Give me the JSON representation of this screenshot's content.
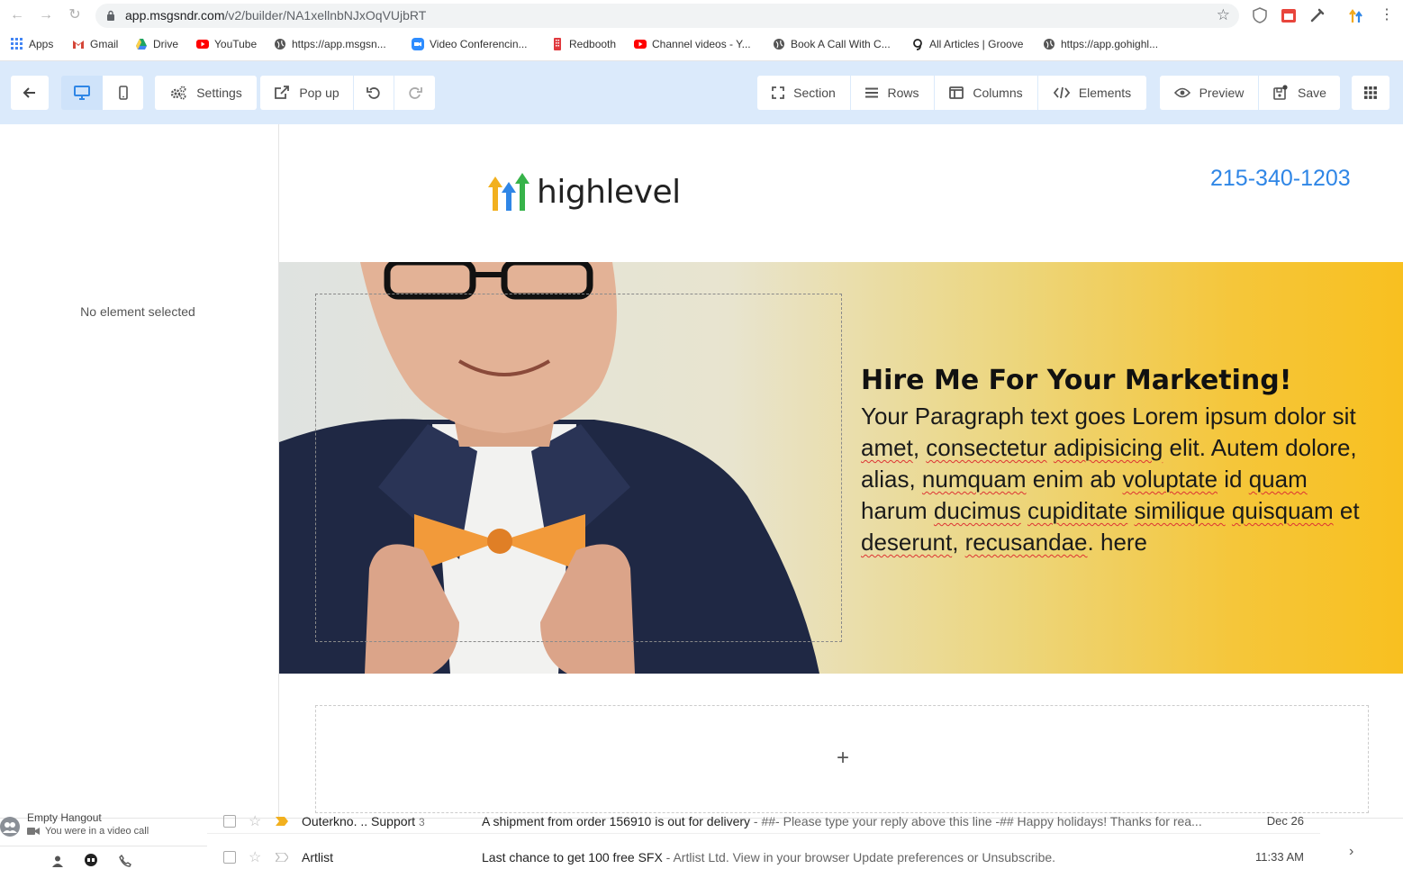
{
  "browser": {
    "url_host": "app.msgsndr.com",
    "url_path": "/v2/builder/NA1xellnbNJxOqVUjbRT",
    "bookmarks": [
      {
        "label": "Apps"
      },
      {
        "label": "Gmail"
      },
      {
        "label": "Drive"
      },
      {
        "label": "YouTube"
      },
      {
        "label": "https://app.msgsn..."
      },
      {
        "label": "Video Conferencin..."
      },
      {
        "label": "Redbooth"
      },
      {
        "label": "Channel videos - Y..."
      },
      {
        "label": "Book A Call With C..."
      },
      {
        "label": "All Articles | Groove"
      },
      {
        "label": "https://app.gohighl..."
      }
    ]
  },
  "toolbar": {
    "settings": "Settings",
    "popup": "Pop up",
    "section": "Section",
    "rows": "Rows",
    "columns": "Columns",
    "elements": "Elements",
    "preview": "Preview",
    "save": "Save"
  },
  "leftpanel": {
    "empty_text": "No element selected"
  },
  "page": {
    "logo_text": "highlevel",
    "phone": "215-340-1203",
    "hero_title": "Hire Me For Your Marketing!",
    "hero_paragraph": {
      "p1": "Your Paragraph text goes Lorem ipsum dolor sit ",
      "w1": "amet",
      "p2": ", ",
      "w2": "consectetur",
      "p3": " ",
      "w3": "adipisicing",
      "p4": " elit. Autem dolore, alias, ",
      "w4": "numquam",
      "p5": " enim ab ",
      "w5": "voluptate",
      "p6": " id ",
      "w6": "quam",
      "p7": " harum ",
      "w7": "ducimus",
      "p8": " ",
      "w8": "cupiditate",
      "p9": " ",
      "w9": "similique",
      "p10": " ",
      "w10": "quisquam",
      "p11": " et ",
      "w11": "deserunt",
      "p12": ", ",
      "w12": "recusandae",
      "p13": ". here"
    },
    "add_row": "+"
  },
  "gmail": {
    "hangout_title": "Empty Hangout",
    "hangout_status": "You were in a video call",
    "rows": [
      {
        "sender": "Outerkno. .. Support",
        "count": "3",
        "subject": "A shipment from order 156910 is out for delivery",
        "snippet": " - ##- Please type your reply above this line -## Happy holidays! Thanks for rea...",
        "date": "Dec 26"
      },
      {
        "sender": "Artlist",
        "count": "",
        "subject": "Last chance to get 100 free SFX",
        "snippet": " - Artlist Ltd. View in your browser Update preferences or Unsubscribe.",
        "date": "11:33 AM"
      }
    ]
  },
  "colors": {
    "toolbar_bg": "#dbeafb",
    "phone": "#2f86e6",
    "hero_yellow": "#f8c020"
  }
}
